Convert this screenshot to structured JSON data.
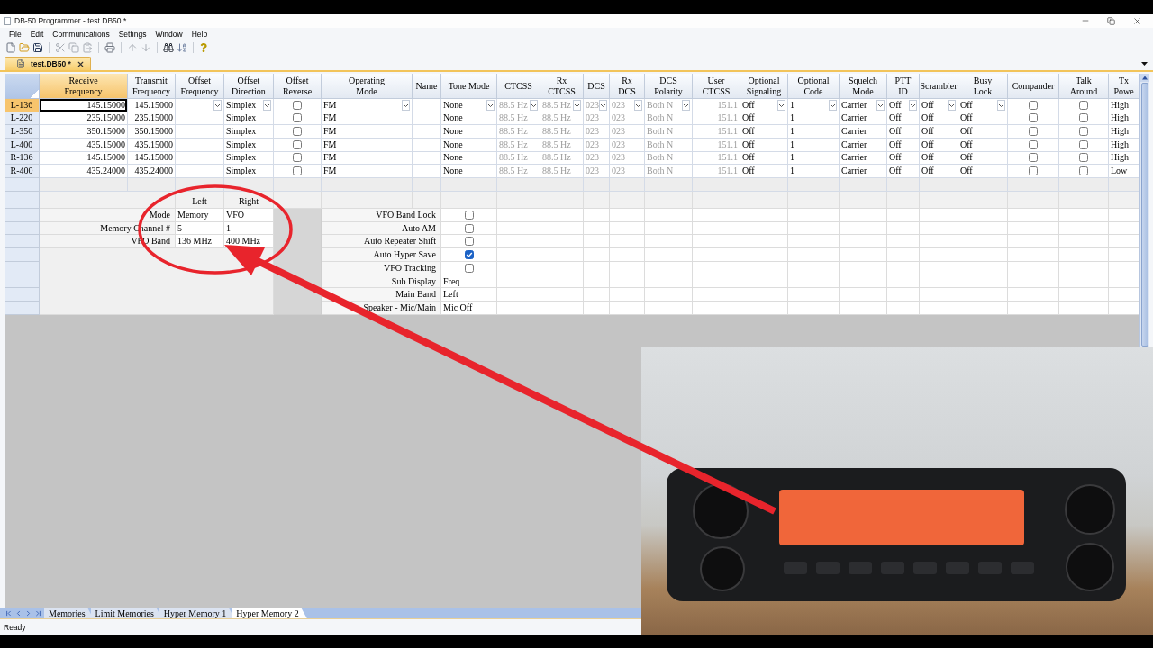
{
  "window": {
    "title": "DB-50 Programmer - test.DB50 *"
  },
  "menu": [
    "File",
    "Edit",
    "Communications",
    "Settings",
    "Window",
    "Help"
  ],
  "document_tabs": [
    {
      "label": "test.DB50 *",
      "selected": true
    }
  ],
  "grid": {
    "columns": [
      {
        "label": "Receive\nFrequency",
        "kind": "number",
        "selected": true
      },
      {
        "label": "Transmit\nFrequency",
        "kind": "number",
        "selected": false
      },
      {
        "label": "Offset\nFrequency",
        "kind": "combo",
        "selected": false
      },
      {
        "label": "Offset\nDirection",
        "kind": "combo",
        "selected": false
      },
      {
        "label": "Offset\nReverse",
        "kind": "check",
        "selected": false
      },
      {
        "label": "Operating\nMode",
        "kind": "combo",
        "selected": false
      },
      {
        "label": "Name",
        "kind": "text",
        "selected": false
      },
      {
        "label": "Tone Mode",
        "kind": "combo",
        "selected": false
      },
      {
        "label": "CTCSS",
        "kind": "combo",
        "selected": false
      },
      {
        "label": "Rx\nCTCSS",
        "kind": "combo",
        "selected": false
      },
      {
        "label": "DCS",
        "kind": "combo",
        "selected": false
      },
      {
        "label": "Rx\nDCS",
        "kind": "combo",
        "selected": false
      },
      {
        "label": "DCS\nPolarity",
        "kind": "combo",
        "selected": false
      },
      {
        "label": "User\nCTCSS",
        "kind": "number",
        "selected": false
      },
      {
        "label": "Optional\nSignaling",
        "kind": "combo",
        "selected": false
      },
      {
        "label": "Optional\nCode",
        "kind": "combo",
        "selected": false
      },
      {
        "label": "Squelch\nMode",
        "kind": "combo",
        "selected": false
      },
      {
        "label": "PTT\nID",
        "kind": "combo",
        "selected": false
      },
      {
        "label": "Scrambler",
        "kind": "combo",
        "selected": false
      },
      {
        "label": "Busy\nLock",
        "kind": "combo",
        "selected": false
      },
      {
        "label": "Compander",
        "kind": "check",
        "selected": false
      },
      {
        "label": "Talk\nAround",
        "kind": "check",
        "selected": false
      },
      {
        "label": "Tx\nPowe",
        "kind": "text",
        "selected": false
      }
    ],
    "rows": [
      {
        "header": "L-136",
        "selected": true,
        "cells": [
          {
            "text": "145.15000",
            "disabled": false
          },
          {
            "text": "145.15000",
            "disabled": false
          },
          {},
          {
            "text": "Simplex",
            "disabled": false
          },
          {
            "checked": false
          },
          {
            "text": "FM",
            "disabled": false
          },
          {},
          {
            "text": "None",
            "disabled": false
          },
          {
            "text": "88.5 Hz",
            "disabled": true
          },
          {
            "text": "88.5 Hz",
            "disabled": true
          },
          {
            "text": "023",
            "disabled": true
          },
          {
            "text": "023",
            "disabled": true
          },
          {
            "text": "Both N",
            "disabled": true
          },
          {
            "text": "151.1",
            "disabled": true
          },
          {
            "text": "Off",
            "disabled": false
          },
          {
            "text": "1",
            "disabled": false
          },
          {
            "text": "Carrier",
            "disabled": false
          },
          {
            "text": "Off",
            "disabled": false
          },
          {
            "text": "Off",
            "disabled": false
          },
          {
            "text": "Off",
            "disabled": false
          },
          {
            "checked": false
          },
          {
            "checked": false
          },
          {
            "text": "High",
            "disabled": false
          }
        ]
      },
      {
        "header": "L-220",
        "selected": false,
        "cells": [
          {
            "text": "235.15000",
            "disabled": false
          },
          {
            "text": "235.15000",
            "disabled": false
          },
          {},
          {
            "text": "Simplex",
            "disabled": false
          },
          {
            "checked": false
          },
          {
            "text": "FM",
            "disabled": false
          },
          {},
          {
            "text": "None",
            "disabled": false
          },
          {
            "text": "88.5 Hz",
            "disabled": true
          },
          {
            "text": "88.5 Hz",
            "disabled": true
          },
          {
            "text": "023",
            "disabled": true
          },
          {
            "text": "023",
            "disabled": true
          },
          {
            "text": "Both N",
            "disabled": true
          },
          {
            "text": "151.1",
            "disabled": true
          },
          {
            "text": "Off",
            "disabled": false
          },
          {
            "text": "1",
            "disabled": false
          },
          {
            "text": "Carrier",
            "disabled": false
          },
          {
            "text": "Off",
            "disabled": false
          },
          {
            "text": "Off",
            "disabled": false
          },
          {
            "text": "Off",
            "disabled": false
          },
          {
            "checked": false
          },
          {
            "checked": false
          },
          {
            "text": "High",
            "disabled": false
          }
        ]
      },
      {
        "header": "L-350",
        "selected": false,
        "cells": [
          {
            "text": "350.15000",
            "disabled": false
          },
          {
            "text": "350.15000",
            "disabled": false
          },
          {},
          {
            "text": "Simplex",
            "disabled": false
          },
          {
            "checked": false
          },
          {
            "text": "FM",
            "disabled": false
          },
          {},
          {
            "text": "None",
            "disabled": false
          },
          {
            "text": "88.5 Hz",
            "disabled": true
          },
          {
            "text": "88.5 Hz",
            "disabled": true
          },
          {
            "text": "023",
            "disabled": true
          },
          {
            "text": "023",
            "disabled": true
          },
          {
            "text": "Both N",
            "disabled": true
          },
          {
            "text": "151.1",
            "disabled": true
          },
          {
            "text": "Off",
            "disabled": false
          },
          {
            "text": "1",
            "disabled": false
          },
          {
            "text": "Carrier",
            "disabled": false
          },
          {
            "text": "Off",
            "disabled": false
          },
          {
            "text": "Off",
            "disabled": false
          },
          {
            "text": "Off",
            "disabled": false
          },
          {
            "checked": false
          },
          {
            "checked": false
          },
          {
            "text": "High",
            "disabled": false
          }
        ]
      },
      {
        "header": "L-400",
        "selected": false,
        "cells": [
          {
            "text": "435.15000",
            "disabled": false
          },
          {
            "text": "435.15000",
            "disabled": false
          },
          {},
          {
            "text": "Simplex",
            "disabled": false
          },
          {
            "checked": false
          },
          {
            "text": "FM",
            "disabled": false
          },
          {},
          {
            "text": "None",
            "disabled": false
          },
          {
            "text": "88.5 Hz",
            "disabled": true
          },
          {
            "text": "88.5 Hz",
            "disabled": true
          },
          {
            "text": "023",
            "disabled": true
          },
          {
            "text": "023",
            "disabled": true
          },
          {
            "text": "Both N",
            "disabled": true
          },
          {
            "text": "151.1",
            "disabled": true
          },
          {
            "text": "Off",
            "disabled": false
          },
          {
            "text": "1",
            "disabled": false
          },
          {
            "text": "Carrier",
            "disabled": false
          },
          {
            "text": "Off",
            "disabled": false
          },
          {
            "text": "Off",
            "disabled": false
          },
          {
            "text": "Off",
            "disabled": false
          },
          {
            "checked": false
          },
          {
            "checked": false
          },
          {
            "text": "High",
            "disabled": false
          }
        ]
      },
      {
        "header": "R-136",
        "selected": false,
        "cells": [
          {
            "text": "145.15000",
            "disabled": false
          },
          {
            "text": "145.15000",
            "disabled": false
          },
          {},
          {
            "text": "Simplex",
            "disabled": false
          },
          {
            "checked": false
          },
          {
            "text": "FM",
            "disabled": false
          },
          {},
          {
            "text": "None",
            "disabled": false
          },
          {
            "text": "88.5 Hz",
            "disabled": true
          },
          {
            "text": "88.5 Hz",
            "disabled": true
          },
          {
            "text": "023",
            "disabled": true
          },
          {
            "text": "023",
            "disabled": true
          },
          {
            "text": "Both N",
            "disabled": true
          },
          {
            "text": "151.1",
            "disabled": true
          },
          {
            "text": "Off",
            "disabled": false
          },
          {
            "text": "1",
            "disabled": false
          },
          {
            "text": "Carrier",
            "disabled": false
          },
          {
            "text": "Off",
            "disabled": false
          },
          {
            "text": "Off",
            "disabled": false
          },
          {
            "text": "Off",
            "disabled": false
          },
          {
            "checked": false
          },
          {
            "checked": false
          },
          {
            "text": "High",
            "disabled": false
          }
        ]
      },
      {
        "header": "R-400",
        "selected": false,
        "cells": [
          {
            "text": "435.24000",
            "disabled": false
          },
          {
            "text": "435.24000",
            "disabled": false
          },
          {},
          {
            "text": "Simplex",
            "disabled": false
          },
          {
            "checked": false
          },
          {
            "text": "FM",
            "disabled": false
          },
          {},
          {
            "text": "None",
            "disabled": false
          },
          {
            "text": "88.5 Hz",
            "disabled": true
          },
          {
            "text": "88.5 Hz",
            "disabled": true
          },
          {
            "text": "023",
            "disabled": true
          },
          {
            "text": "023",
            "disabled": true
          },
          {
            "text": "Both N",
            "disabled": true
          },
          {
            "text": "151.1",
            "disabled": true
          },
          {
            "text": "Off",
            "disabled": false
          },
          {
            "text": "1",
            "disabled": false
          },
          {
            "text": "Carrier",
            "disabled": false
          },
          {
            "text": "Off",
            "disabled": false
          },
          {
            "text": "Off",
            "disabled": false
          },
          {
            "text": "Off",
            "disabled": false
          },
          {
            "checked": false
          },
          {
            "checked": false
          },
          {
            "text": "Low",
            "disabled": false
          }
        ]
      }
    ]
  },
  "vfo_panel": {
    "columns": [
      "Left",
      "Right"
    ],
    "rows": [
      {
        "label": "Mode",
        "values": [
          "Memory",
          "VFO"
        ]
      },
      {
        "label": "Memory Channel #",
        "values": [
          "5",
          "1"
        ]
      },
      {
        "label": "VFO Band",
        "values": [
          "136 MHz",
          "400 MHz"
        ]
      }
    ]
  },
  "options_panel": {
    "rows": [
      {
        "label": "VFO Band Lock",
        "kind": "check",
        "checked": false
      },
      {
        "label": "Auto AM",
        "kind": "check",
        "checked": false
      },
      {
        "label": "Auto Repeater Shift",
        "kind": "check",
        "checked": false
      },
      {
        "label": "Auto Hyper Save",
        "kind": "check",
        "checked": true
      },
      {
        "label": "VFO Tracking",
        "kind": "check",
        "checked": false
      },
      {
        "label": "Sub Display",
        "kind": "text",
        "value": "Freq"
      },
      {
        "label": "Main Band",
        "kind": "text",
        "value": "Left"
      },
      {
        "label": "Speaker - Mic/Main",
        "kind": "text",
        "value": "Mic Off"
      }
    ]
  },
  "sheet_tabs": [
    {
      "label": "Memories",
      "selected": false
    },
    {
      "label": "Limit Memories",
      "selected": false
    },
    {
      "label": "Hyper Memory 1",
      "selected": false
    },
    {
      "label": "Hyper Memory 2",
      "selected": true
    }
  ],
  "status_bar": {
    "text": "Ready"
  }
}
